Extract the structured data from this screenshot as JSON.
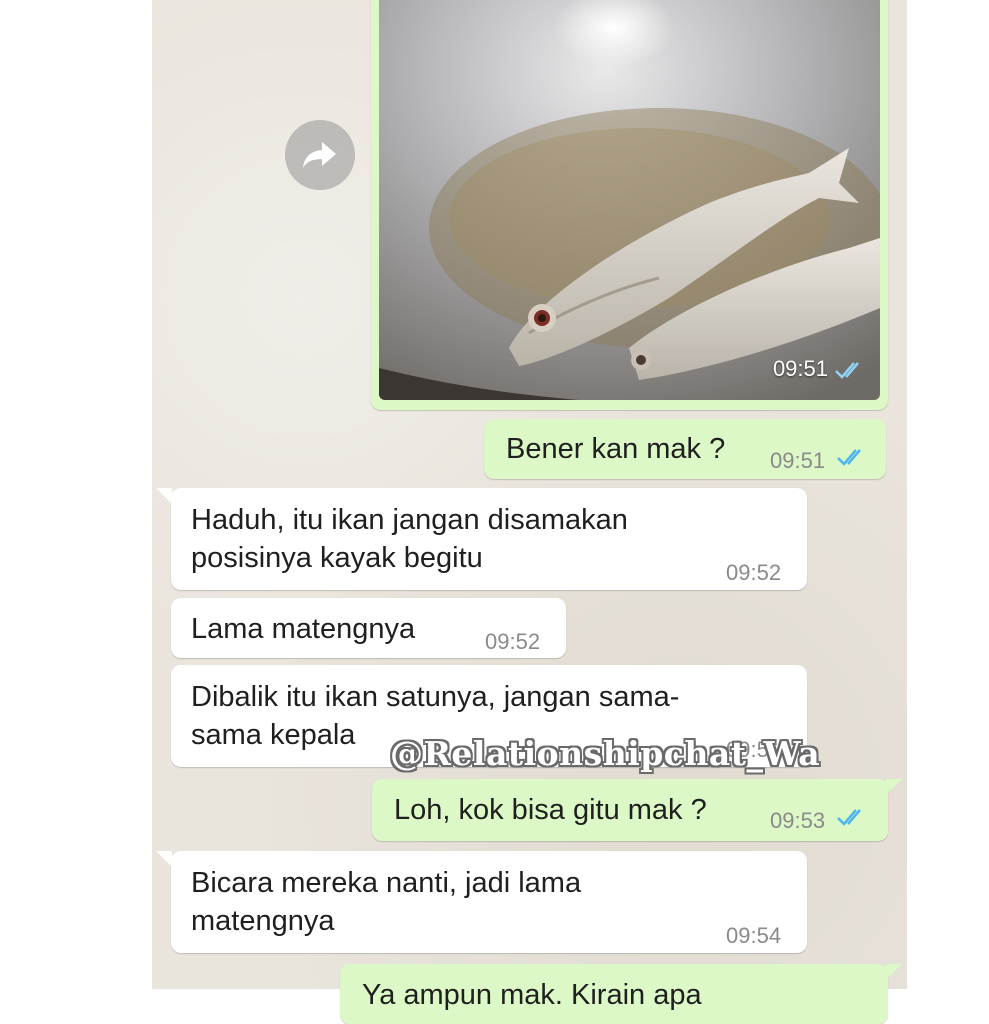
{
  "chat": {
    "image_message": {
      "time": "09:51",
      "status": "read"
    },
    "messages": [
      {
        "direction": "out",
        "text": "Bener kan mak ?",
        "time": "09:51",
        "status": "read"
      },
      {
        "direction": "in",
        "text": "Haduh, itu ikan jangan disamakan\nposisinya kayak begitu",
        "time": "09:52"
      },
      {
        "direction": "in",
        "text": "Lama matengnya",
        "time": "09:52"
      },
      {
        "direction": "in",
        "text": "Dibalik itu ikan satunya, jangan sama-\nsama kepala",
        "time": "09:5"
      },
      {
        "direction": "out",
        "text": "Loh, kok bisa gitu mak ?",
        "time": "09:53",
        "status": "read"
      },
      {
        "direction": "in",
        "text": "Bicara mereka nanti, jadi lama\nmatengnya",
        "time": "09:54"
      },
      {
        "direction": "out",
        "text": "Ya ampun mak. Kirain apa",
        "time": ""
      }
    ]
  },
  "watermark": "@Relationshipchat_Wa",
  "icons": {
    "forward": "forward-arrow-icon",
    "read_receipt": "double-check-icon"
  },
  "colors": {
    "outgoing_bubble": "#dcf8c6",
    "incoming_bubble": "#ffffff",
    "chat_background": "#e9e4dc",
    "read_tick": "#4fb6ec",
    "timestamp": "#8a8a8a"
  }
}
